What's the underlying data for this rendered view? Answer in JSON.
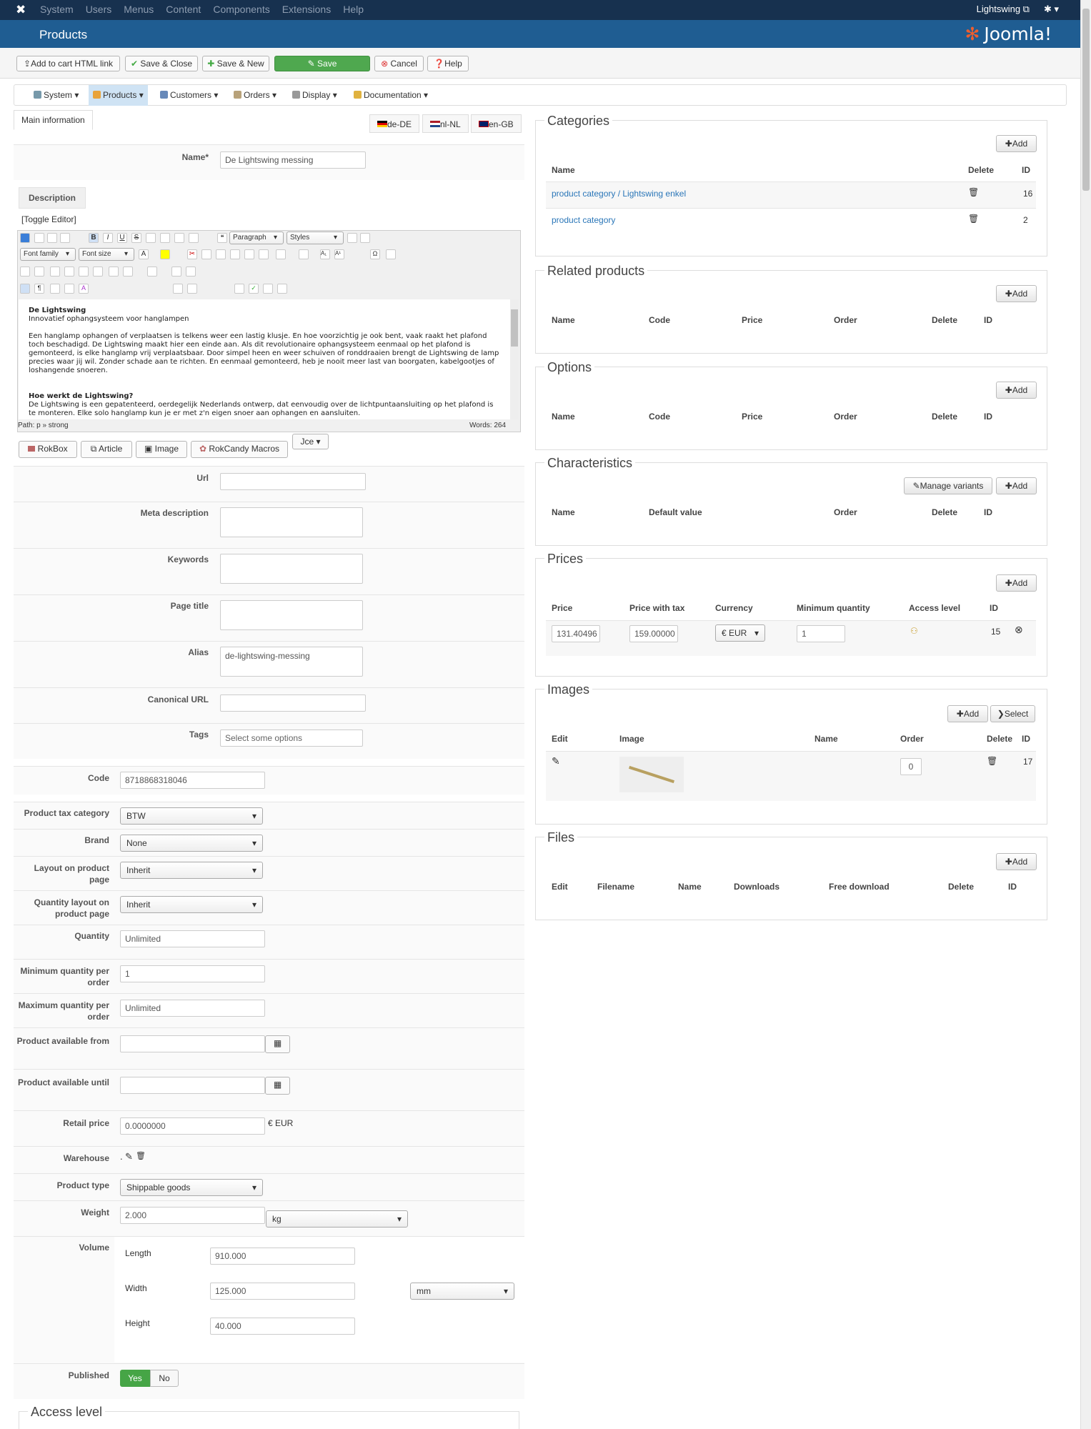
{
  "topbar": {
    "nav": [
      "System",
      "Users",
      "Menus",
      "Content",
      "Components",
      "Extensions",
      "Help"
    ],
    "site": "Lightswing ⧉",
    "settings": "✱ ▾"
  },
  "header": {
    "title": "Products",
    "brand": "Joomla!"
  },
  "toolbar": {
    "add_cart": "Add to cart HTML link",
    "save_close": "Save & Close",
    "save_new": "Save & New",
    "save": "Save",
    "cancel": "Cancel",
    "help": "Help"
  },
  "submenu": [
    "System",
    "Products",
    "Customers",
    "Orders",
    "Display",
    "Documentation"
  ],
  "tabs": {
    "main": "Main information",
    "langs": [
      "de-DE",
      "nl-NL",
      "en-GB"
    ]
  },
  "form": {
    "name_label": "Name*",
    "name": "De Lightswing messing",
    "description_tab": "Description",
    "toggle": "[Toggle Editor]",
    "editor": {
      "format": "Paragraph",
      "styles": "Styles",
      "font_family": "Font family",
      "font_size": "Font size",
      "path": "Path:  p » strong",
      "words": "Words: 264",
      "h1": "De Lightswing",
      "p1": "Innovatief ophangsysteem voor hanglampen",
      "p2": "Een hanglamp ophangen of verplaatsen is telkens weer een lastig klusje. En hoe voorzichtig je ook bent, vaak raakt het plafond toch beschadigd. De Lightswing maakt hier een einde aan. Als dit revolutionaire ophangsysteem eenmaal op het plafond is gemonteerd, is elke hanglamp vrij verplaatsbaar. Door simpel heen en weer schuiven of ronddraaien brengt de Lightswing de lamp precies waar jij wil. Zonder schade aan te richten. En eenmaal gemonteerd, heb je nooit meer last van boorgaten, kabelgootjes of loshangende snoeren.",
      "h2": "Hoe werkt de Lightswing?",
      "p3": "De Lightswing is een gepatenteerd, oerdegelijk Nederlands ontwerp, dat eenvoudig over de lichtpuntaansluiting op het plafond is te monteren. Elke solo hanglamp kun je er met z'n eigen snoer aan ophangen en aansluiten."
    },
    "plugins": [
      "RokBox",
      "Article",
      "Image",
      "RokCandy Macros",
      "Jce ▾"
    ],
    "url": "Url",
    "meta": "Meta description",
    "keywords": "Keywords",
    "page_title": "Page title",
    "alias_label": "Alias",
    "alias": "de-lightswing-messing",
    "canonical": "Canonical URL",
    "tags_label": "Tags",
    "tags_placeholder": "Select some options",
    "code_label": "Code",
    "code": "8718868318046",
    "tax_label": "Product tax category",
    "tax": "BTW",
    "brand_label": "Brand",
    "brand": "None",
    "layout_label": "Layout on product page",
    "layout": "Inherit",
    "qlayout_label": "Quantity layout on product page",
    "qlayout": "Inherit",
    "qty_label": "Quantity",
    "qty": "Unlimited",
    "minq_label": "Minimum quantity per order",
    "minq": "1",
    "maxq_label": "Maximum quantity per order",
    "maxq": "Unlimited",
    "from_label": "Product available from",
    "until_label": "Product available until",
    "retail_label": "Retail price",
    "retail": "0.0000000",
    "currency": "€ EUR",
    "warehouse_label": "Warehouse",
    "warehouse": ".",
    "type_label": "Product type",
    "type": "Shippable goods",
    "weight_label": "Weight",
    "weight": "2.000",
    "weight_unit": "kg",
    "volume_label": "Volume",
    "length_label": "Length",
    "length": "910.000",
    "width_label": "Width",
    "width": "125.000",
    "height_label": "Height",
    "height": "40.000",
    "dim_unit": "mm",
    "published_label": "Published",
    "yes": "Yes",
    "no": "No",
    "access": "Access level"
  },
  "right": {
    "categories": {
      "title": "Categories",
      "add": "Add",
      "cols": [
        "Name",
        "Delete",
        "ID"
      ],
      "rows": [
        {
          "name": "product category / Lightswing enkel",
          "id": "16"
        },
        {
          "name": "product category",
          "id": "2"
        }
      ]
    },
    "related": {
      "title": "Related products",
      "add": "Add",
      "cols": [
        "Name",
        "Code",
        "Price",
        "Order",
        "Delete",
        "ID"
      ]
    },
    "options": {
      "title": "Options",
      "add": "Add",
      "cols": [
        "Name",
        "Code",
        "Price",
        "Order",
        "Delete",
        "ID"
      ]
    },
    "characteristics": {
      "title": "Characteristics",
      "manage": "Manage variants",
      "add": "Add",
      "cols": [
        "Name",
        "Default value",
        "Order",
        "Delete",
        "ID"
      ]
    },
    "prices": {
      "title": "Prices",
      "add": "Add",
      "cols": [
        "Price",
        "Price with tax",
        "Currency",
        "Minimum quantity",
        "Access level",
        "ID"
      ],
      "price": "131.40496",
      "price_tax": "159.00000",
      "currency": "€ EUR",
      "min": "1",
      "id": "15"
    },
    "images": {
      "title": "Images",
      "add": "Add",
      "select": "Select",
      "cols": [
        "Edit",
        "Image",
        "Name",
        "Order",
        "Delete",
        "ID"
      ],
      "order": "0",
      "id": "17"
    },
    "files": {
      "title": "Files",
      "add": "Add",
      "cols": [
        "Edit",
        "Filename",
        "Name",
        "Downloads",
        "Free download",
        "Delete",
        "ID"
      ]
    }
  }
}
